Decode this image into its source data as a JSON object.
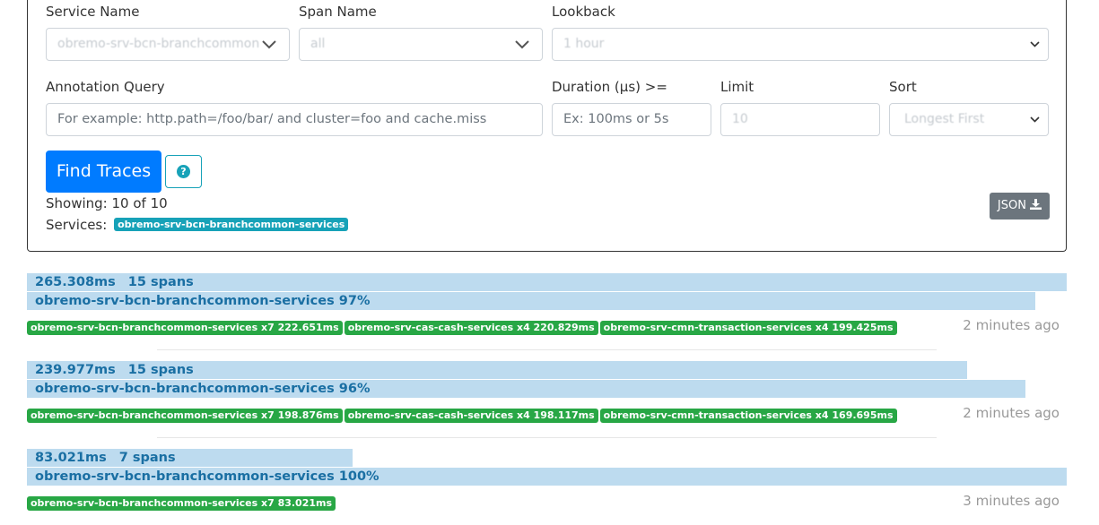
{
  "search": {
    "service_name_label": "Service Name",
    "service_name_value": "obremo-srv-bcn-branchcommon",
    "span_name_label": "Span Name",
    "span_name_value": "all",
    "lookback_label": "Lookback",
    "lookback_value": "1 hour",
    "annotation_label": "Annotation Query",
    "annotation_placeholder": "For example: http.path=/foo/bar/ and cluster=foo and cache.miss",
    "duration_label": "Duration (μs) >=",
    "duration_placeholder": "Ex: 100ms or 5s",
    "limit_label": "Limit",
    "limit_value": "10",
    "sort_label": "Sort",
    "sort_value": "Longest First",
    "find_button": "Find Traces",
    "help_icon_glyph": "?",
    "showing": "Showing: 10 of 10",
    "services_label": "Services:",
    "services_badge": "obremo-srv-bcn-branchcommon-services",
    "json_button": "JSON"
  },
  "colors": {
    "primary": "#007bff",
    "info": "#17a2b8",
    "success": "#28a745",
    "secondary": "#6c757d",
    "bar": "#bddbef",
    "bar_text": "#1a6fa3"
  },
  "icons": {
    "select_chevron": "chevron-down-icon",
    "help": "question-circle-icon",
    "download": "download-icon"
  },
  "traces": [
    {
      "duration": "265.308ms",
      "spans": "15 spans",
      "duration_fraction": 1.0,
      "service_line": "obremo-srv-bcn-branchcommon-services 97%",
      "service_fraction": 0.97,
      "chips": [
        "obremo-srv-bcn-branchcommon-services x7 222.651ms",
        "obremo-srv-cas-cash-services x4 220.829ms",
        "obremo-srv-cmn-transaction-services x4 199.425ms"
      ],
      "ago": "2 minutes ago"
    },
    {
      "duration": "239.977ms",
      "spans": "15 spans",
      "duration_fraction": 0.9045,
      "service_line": "obremo-srv-bcn-branchcommon-services 96%",
      "service_fraction": 0.96,
      "chips": [
        "obremo-srv-bcn-branchcommon-services x7 198.876ms",
        "obremo-srv-cas-cash-services x4 198.117ms",
        "obremo-srv-cmn-transaction-services x4 169.695ms"
      ],
      "ago": "2 minutes ago"
    },
    {
      "duration": "83.021ms",
      "spans": "7 spans",
      "duration_fraction": 0.3129,
      "service_line": "obremo-srv-bcn-branchcommon-services 100%",
      "service_fraction": 1.0,
      "chips": [
        "obremo-srv-bcn-branchcommon-services x7 83.021ms"
      ],
      "ago": "3 minutes ago"
    }
  ]
}
